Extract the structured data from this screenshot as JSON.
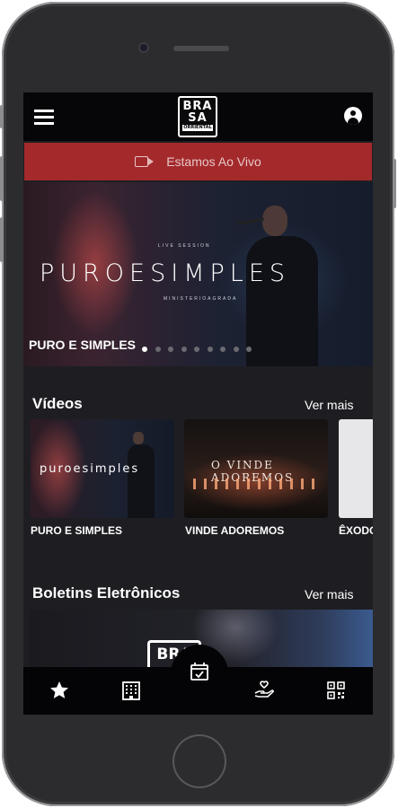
{
  "header": {
    "logo": {
      "line1": "BRA",
      "line2": "SA",
      "line3": "ORRIENTAL"
    },
    "menu_icon": "hamburger-menu-icon",
    "account_icon": "account-circle-icon"
  },
  "live_bar": {
    "label": "Estamos Ao Vivo",
    "icon": "video-camera-icon",
    "color": "#a3292b"
  },
  "hero": {
    "small_top": "LIVE SESSION",
    "title_art": "PUROESIMPLES",
    "small_bottom": "MINISTERIOAGRADA",
    "caption": "PURO E SIMPLES",
    "dots_total": 9,
    "active_dot": 0
  },
  "videos": {
    "title": "Vídeos",
    "more_label": "Ver mais",
    "items": [
      {
        "art": "puroesimples",
        "label": "PURO E SIMPLES"
      },
      {
        "art": "O VINDE ADOREMOS",
        "label": "VINDE ADOREMOS"
      },
      {
        "art": "",
        "label": "ÊXODO"
      }
    ]
  },
  "bulletins": {
    "title": "Boletins Eletrônicos",
    "more_label": "Ver mais",
    "banner_logo": "BRA"
  },
  "bottom_nav": {
    "items": [
      {
        "icon": "star-icon"
      },
      {
        "icon": "building-icon"
      },
      {
        "icon": "calendar-check-icon",
        "active": true
      },
      {
        "icon": "hand-heart-icon"
      },
      {
        "icon": "qr-code-icon"
      }
    ]
  }
}
